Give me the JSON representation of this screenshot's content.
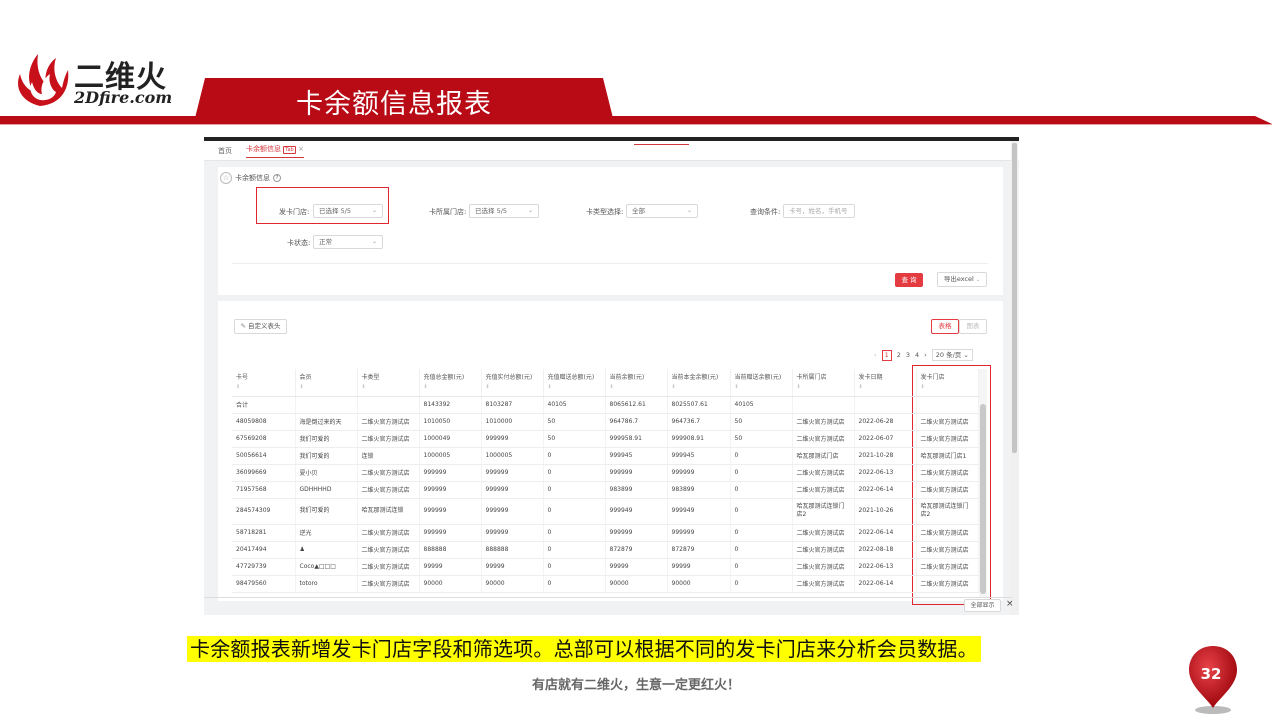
{
  "brand": {
    "name_cn": "二维火",
    "name_en": "2Dfire.com",
    "color": "#b80b16"
  },
  "slide": {
    "title": "卡余额信息报表",
    "caption": "卡余额报表新增发卡门店字段和筛选项。总部可以根据不同的发卡门店来分析会员数据。",
    "slogan": "有店就有二维火，生意一定更红火！",
    "page_number": "32"
  },
  "app": {
    "tabs": [
      "首页",
      "卡余额信息"
    ],
    "tab_badge": "Tab",
    "page_title": "卡余额信息",
    "filters": {
      "issue_store_label": "发卡门店:",
      "issue_store_value": "已选择 5/5",
      "card_store_label": "卡所属门店:",
      "card_store_value": "已选择 5/5",
      "card_type_label": "卡类型选择:",
      "card_type_value": "全部",
      "query_label": "查询条件:",
      "query_placeholder": "卡号，姓名，手机号",
      "status_label": "卡状态:",
      "status_value": "正常"
    },
    "buttons": {
      "query": "查 询",
      "export": "导出excel",
      "custom_header": "自定义表头",
      "table_view": "表格",
      "chart_view": "图表",
      "show_all": "全部显示"
    },
    "pagination": {
      "pages": [
        "1",
        "2",
        "3",
        "4"
      ],
      "per_page": "20 条/页"
    },
    "table": {
      "columns": [
        "卡号",
        "会员",
        "卡类型",
        "充值总金额(元)",
        "充值实付总额(元)",
        "充值赠送总额(元)",
        "当前余额(元)",
        "当前本金余额(元)",
        "当前赠送余额(元)",
        "卡所属门店",
        "发卡日期",
        "发卡门店"
      ],
      "rows": [
        [
          "合计",
          "",
          "",
          "8143392",
          "8103287",
          "40105",
          "8065612.61",
          "8025507.61",
          "40105",
          "",
          "",
          ""
        ],
        [
          "48059808",
          "海是倒过来的天",
          "二维火官方测试店",
          "1010050",
          "1010000",
          "50",
          "964786.7",
          "964736.7",
          "50",
          "二维火官方测试店",
          "2022-06-28",
          "二维火官方测试店"
        ],
        [
          "67569208",
          "我们可爱的",
          "二维火官方测试店",
          "1000049",
          "999999",
          "50",
          "999958.91",
          "999908.91",
          "50",
          "二维火官方测试店",
          "2022-06-07",
          "二维火官方测试店"
        ],
        [
          "50056614",
          "我们可爱的",
          "连锁",
          "1000005",
          "1000005",
          "0",
          "999945",
          "999945",
          "0",
          "哈瓦那测试门店",
          "2021-10-28",
          "哈瓦那测试门店1"
        ],
        [
          "36099669",
          "夏小贝",
          "二维火官方测试店",
          "999999",
          "999999",
          "0",
          "999999",
          "999999",
          "0",
          "二维火官方测试店",
          "2022-06-13",
          "二维火官方测试店"
        ],
        [
          "71957568",
          "GDHHHHD",
          "二维火官方测试店",
          "999999",
          "999999",
          "0",
          "983899",
          "983899",
          "0",
          "二维火官方测试店",
          "2022-06-14",
          "二维火官方测试店"
        ],
        [
          "284574309",
          "我们可爱的",
          "哈瓦那测试连锁",
          "999999",
          "999999",
          "0",
          "999949",
          "999949",
          "0",
          "哈瓦那测试连锁门店2",
          "2021-10-26",
          "哈瓦那测试连锁门店2"
        ],
        [
          "58718281",
          "逆光",
          "二维火官方测试店",
          "999999",
          "999999",
          "0",
          "999999",
          "999999",
          "0",
          "二维火官方测试店",
          "2022-06-14",
          "二维火官方测试店"
        ],
        [
          "20417494",
          "♟",
          "二维火官方测试店",
          "888888",
          "888888",
          "0",
          "872879",
          "872879",
          "0",
          "二维火官方测试店",
          "2022-08-18",
          "二维火官方测试店"
        ],
        [
          "47729739",
          "Coco▲□□□",
          "二维火官方测试店",
          "99999",
          "99999",
          "0",
          "99999",
          "99999",
          "0",
          "二维火官方测试店",
          "2022-06-13",
          "二维火官方测试店"
        ],
        [
          "98479560",
          "totoro",
          "二维火官方测试店",
          "90000",
          "90000",
          "0",
          "90000",
          "90000",
          "0",
          "二维火官方测试店",
          "2022-06-14",
          "二维火官方测试店"
        ]
      ]
    }
  }
}
